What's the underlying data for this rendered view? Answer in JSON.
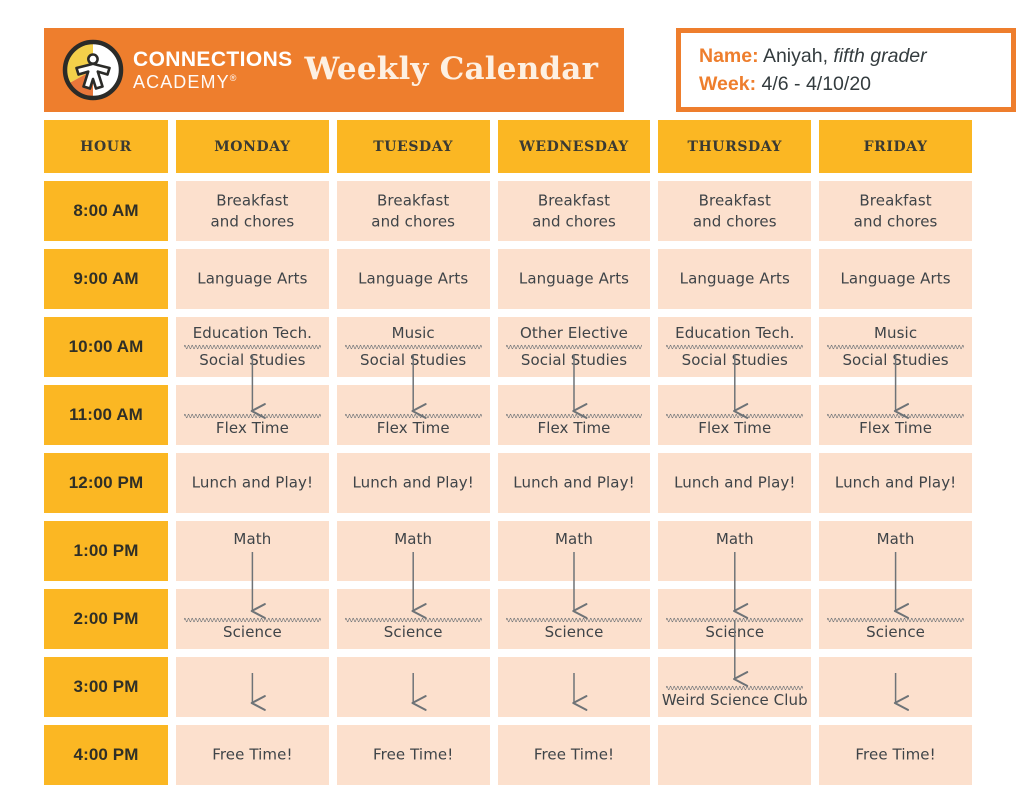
{
  "header": {
    "logo": {
      "icon": "connections-academy-logo-icon",
      "line1": "CONNECTIONS",
      "line2": "ACADEMY",
      "registered_mark": "®"
    },
    "title": "Weekly Calendar",
    "info": {
      "name_label": "Name:",
      "name_value": "Aniyah,",
      "name_value_italic": "fifth grader",
      "week_label": "Week:",
      "week_value": "4/6 - 4/10/20"
    }
  },
  "colors": {
    "orange": "#ee7e2d",
    "amber": "#fbb723",
    "peach": "#fce0cd",
    "ink": "#3f4448",
    "header_text": "#3a3a32",
    "banner_title": "#fdf0e2"
  },
  "table": {
    "columns": [
      "HOUR",
      "MONDAY",
      "TUESDAY",
      "WEDNESDAY",
      "THURSDAY",
      "FRIDAY"
    ],
    "hours": [
      "8:00 AM",
      "9:00 AM",
      "10:00 AM",
      "11:00 AM",
      "12:00 PM",
      "1:00 PM",
      "2:00 PM",
      "3:00 PM",
      "4:00 PM"
    ],
    "rows": [
      {
        "hour": "8:00 AM",
        "cells": [
          {
            "line1": "Breakfast",
            "line2": "and chores"
          },
          {
            "line1": "Breakfast",
            "line2": "and chores"
          },
          {
            "line1": "Breakfast",
            "line2": "and chores"
          },
          {
            "line1": "Breakfast",
            "line2": "and chores"
          },
          {
            "line1": "Breakfast",
            "line2": "and chores"
          }
        ]
      },
      {
        "hour": "9:00 AM",
        "cells": [
          {
            "line1": "Language Arts"
          },
          {
            "line1": "Language Arts"
          },
          {
            "line1": "Language Arts"
          },
          {
            "line1": "Language Arts"
          },
          {
            "line1": "Language Arts"
          }
        ]
      },
      {
        "hour": "10:00 AM",
        "cells": [
          {
            "top": "Education Tech.",
            "bottom": "Social Studies",
            "wavy": true
          },
          {
            "top": "Music",
            "bottom": "Social Studies",
            "wavy": true
          },
          {
            "top": "Other Elective",
            "bottom": "Social Studies",
            "wavy": true
          },
          {
            "top": "Education Tech.",
            "bottom": "Social Studies",
            "wavy": true
          },
          {
            "top": "Music",
            "bottom": "Social Studies",
            "wavy": true
          }
        ]
      },
      {
        "hour": "11:00 AM",
        "cells": [
          {
            "bottom": "Flex Time",
            "wavy": true,
            "arrow_in": true
          },
          {
            "bottom": "Flex Time",
            "wavy": true,
            "arrow_in": true
          },
          {
            "bottom": "Flex Time",
            "wavy": true,
            "arrow_in": true
          },
          {
            "bottom": "Flex Time",
            "wavy": true,
            "arrow_in": true
          },
          {
            "bottom": "Flex Time",
            "wavy": true,
            "arrow_in": true
          }
        ]
      },
      {
        "hour": "12:00 PM",
        "cells": [
          {
            "line1": "Lunch and Play!"
          },
          {
            "line1": "Lunch and Play!"
          },
          {
            "line1": "Lunch and Play!"
          },
          {
            "line1": "Lunch and Play!"
          },
          {
            "line1": "Lunch and Play!"
          }
        ]
      },
      {
        "hour": "1:00 PM",
        "cells": [
          {
            "top": "Math",
            "arrow_out": true
          },
          {
            "top": "Math",
            "arrow_out": true
          },
          {
            "top": "Math",
            "arrow_out": true
          },
          {
            "top": "Math",
            "arrow_out": true
          },
          {
            "top": "Math",
            "arrow_out": true
          }
        ]
      },
      {
        "hour": "2:00 PM",
        "cells": [
          {
            "bottom": "Science",
            "wavy": true,
            "arrow_in": true
          },
          {
            "bottom": "Science",
            "wavy": true,
            "arrow_in": true
          },
          {
            "bottom": "Science",
            "wavy": true,
            "arrow_in": true
          },
          {
            "bottom": "Science",
            "wavy": true,
            "arrow_in": true,
            "arrow_out": true
          },
          {
            "bottom": "Science",
            "wavy": true,
            "arrow_in": true
          }
        ]
      },
      {
        "hour": "3:00 PM",
        "cells": [
          {
            "arrow_only": true
          },
          {
            "arrow_only": true
          },
          {
            "arrow_only": true
          },
          {
            "bottom": "Weird Science Club",
            "wavy": true,
            "arrow_in": true
          },
          {
            "arrow_only": true
          }
        ]
      },
      {
        "hour": "4:00 PM",
        "cells": [
          {
            "line1": "Free Time!"
          },
          {
            "line1": "Free Time!"
          },
          {
            "line1": "Free Time!"
          },
          {
            "arrow_only": true
          },
          {
            "line1": "Free Time!"
          }
        ]
      }
    ]
  }
}
